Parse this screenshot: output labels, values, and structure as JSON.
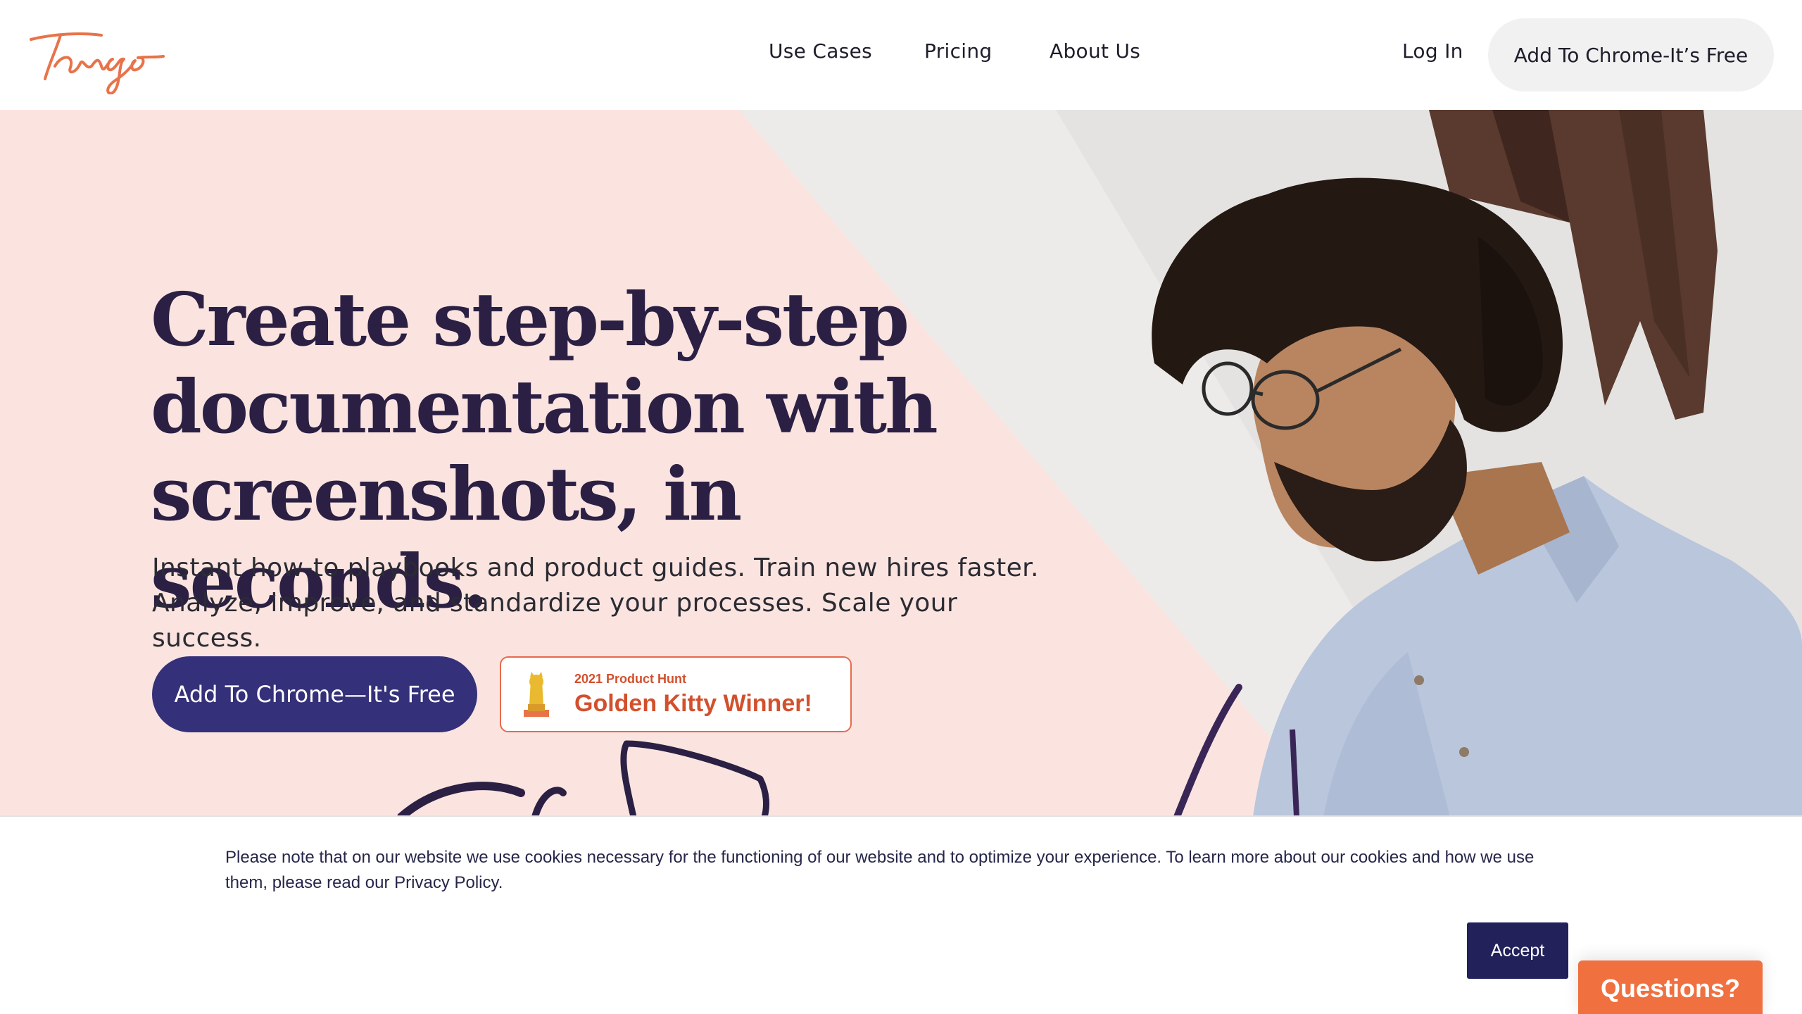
{
  "nav": {
    "logo_text": "Tango",
    "links": [
      "Use Cases",
      "Pricing",
      "About Us"
    ],
    "login": "Log In",
    "cta": "Add To Chrome-It’s Free"
  },
  "hero": {
    "title_lines": [
      "Create step-by-step",
      "documentation with",
      "screenshots, in seconds."
    ],
    "subtitle_lines": [
      "Instant how-to playbooks and product guides. Train new hires faster.",
      "Analyze, improve, and standardize your processes. Scale your success."
    ],
    "cta": "Add To Chrome—It's Free",
    "badge": {
      "small": "2021 Product Hunt",
      "big": "Golden Kitty Winner!"
    }
  },
  "cookie": {
    "text": "Please note that on our website we use cookies necessary for the functioning of our website and to optimize your experience. To learn more about our cookies and how we use them, please read our ",
    "link": "Privacy Policy",
    "after": ".",
    "accept": "Accept"
  },
  "chat": {
    "label": "Questions?"
  },
  "colors": {
    "brand_orange": "#e8734a",
    "hero_bg": "#fbe4e0",
    "primary_button": "#35307a",
    "accept_button": "#22215a",
    "questions_button": "#f0703f",
    "heading": "#2b2044"
  }
}
